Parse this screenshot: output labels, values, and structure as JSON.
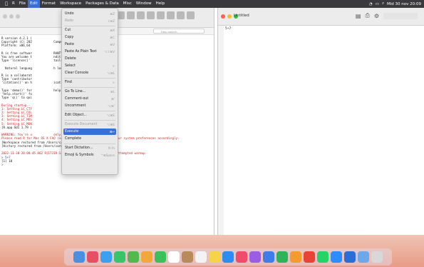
{
  "menubar": {
    "apple": "",
    "items": [
      "R",
      "File",
      "Edit",
      "Format",
      "Workspace",
      "Packages & Data",
      "Misc",
      "Window",
      "Help"
    ],
    "active_index": 2,
    "clock": "Mid 30 nov 20:09"
  },
  "console": {
    "help_search_placeholder": "Help search",
    "lines": [
      {
        "t": "R version 4.2.1 (",
        "c": "black"
      },
      {
        "t": "Copyright (C) 202            Computing",
        "c": "black"
      },
      {
        "t": "Platform: x86_64",
        "c": "black"
      },
      {
        "t": "",
        "c": "black"
      },
      {
        "t": "R is free softwar            RANTY.",
        "c": "black"
      },
      {
        "t": "You are welcome t            nditions.",
        "c": "black"
      },
      {
        "t": "Type 'license()'             tails.",
        "c": "black"
      },
      {
        "t": "",
        "c": "black"
      },
      {
        "t": "  Natural languag            h locale",
        "c": "black"
      },
      {
        "t": "",
        "c": "black"
      },
      {
        "t": "R is a collaborat",
        "c": "black"
      },
      {
        "t": "Type 'contributor",
        "c": "black"
      },
      {
        "t": "'citation()' on h            ications.",
        "c": "black"
      },
      {
        "t": "",
        "c": "black"
      },
      {
        "t": "Type 'demo()' for            help, or",
        "c": "black"
      },
      {
        "t": "'help.start()' fo",
        "c": "black"
      },
      {
        "t": "Type 'q()' to qui",
        "c": "black"
      },
      {
        "t": "",
        "c": "black"
      },
      {
        "t": "During startup -",
        "c": "red"
      },
      {
        "t": "1: Setting LC_CTY",
        "c": "red"
      },
      {
        "t": "2: Setting LC_COL",
        "c": "red"
      },
      {
        "t": "3: Setting LC_TIM",
        "c": "red"
      },
      {
        "t": "4: Setting LC_MES",
        "c": "red"
      },
      {
        "t": "5: Setting LC_MON",
        "c": "red"
      },
      {
        "t": "[R.app GUI 1.79 (",
        "c": "black"
      },
      {
        "t": "",
        "c": "black"
      },
      {
        "t": "WARNING: You're u            only ASCII characters will work.",
        "c": "red"
      },
      {
        "t": "Please read R for Mac OS X FAQ (see Help) section 9 and adjust your system preferences accordingly.",
        "c": "red"
      },
      {
        "t": "[Workspace restored from /Users/carmenmoreno/.RData]",
        "c": "black"
      },
      {
        "t": "[History restored from /Users/carmenmoreno/.Rapp.history]",
        "c": "black"
      },
      {
        "t": "",
        "c": "black"
      },
      {
        "t": "2022-11-30 20:08:45.862 R[17219:1487245] +[NSSavePanel _warmUp] attempted warmup",
        "c": "red"
      },
      {
        "t": "> 5+7",
        "c": "blue"
      },
      {
        "t": "[1] 10",
        "c": "black"
      },
      {
        "t": ">",
        "c": "blue"
      }
    ]
  },
  "edit_menu": [
    {
      "label": "Undo",
      "sc": "⌘Z",
      "disabled": false,
      "sep_after": false
    },
    {
      "label": "Redo",
      "sc": "⇧⌘Z",
      "disabled": true,
      "sep_after": true
    },
    {
      "label": "Cut",
      "sc": "⌘X",
      "disabled": false,
      "sep_after": false
    },
    {
      "label": "Copy",
      "sc": "⌘C",
      "disabled": false,
      "sep_after": false
    },
    {
      "label": "Paste",
      "sc": "⌘V",
      "disabled": false,
      "sep_after": false
    },
    {
      "label": "Paste As Plain Text",
      "sc": "⌥⇧⌘V",
      "disabled": false,
      "sep_after": false
    },
    {
      "label": "Delete",
      "sc": "",
      "disabled": false,
      "sep_after": false
    },
    {
      "label": "Select",
      "sc": ">",
      "disabled": false,
      "sep_after": false
    },
    {
      "label": "Clear Console",
      "sc": "⌥⌘L",
      "disabled": false,
      "sep_after": true
    },
    {
      "label": "Find",
      "sc": ">",
      "disabled": false,
      "sep_after": true
    },
    {
      "label": "Go To Line...",
      "sc": "⌘L",
      "disabled": false,
      "sep_after": false
    },
    {
      "label": "Comment-out",
      "sc": "⌘'",
      "disabled": false,
      "sep_after": false
    },
    {
      "label": "Uncomment",
      "sc": "⌥⌘'",
      "disabled": false,
      "sep_after": true
    },
    {
      "label": "Edit Object...",
      "sc": "⌥⌘E",
      "disabled": false,
      "sep_after": true
    },
    {
      "label": "Execute Document",
      "sc": "⌥⌘E",
      "disabled": true,
      "sep_after": false
    },
    {
      "label": "Execute",
      "sc": "⌘↩",
      "disabled": false,
      "selected": true,
      "sep_after": false
    },
    {
      "label": "Complete",
      "sc": "",
      "disabled": false,
      "sep_after": true
    },
    {
      "label": "Start Dictation...",
      "sc": "fn fn",
      "disabled": false,
      "sep_after": false
    },
    {
      "label": "Emoji & Symbols",
      "sc": "^⌘Space",
      "disabled": false,
      "sep_after": false
    }
  ],
  "editor": {
    "title": "Untitled",
    "code": "5+7"
  },
  "colors": {
    "menubar": "#3a3a3c",
    "selection": "#3a6fd8"
  },
  "dock_icons": [
    "finder-icon",
    "launchpad-icon",
    "safari-icon",
    "messages-icon",
    "maps-icon",
    "photos-icon",
    "facetime-icon",
    "calendar-icon",
    "contacts-icon",
    "reminders-icon",
    "notes-icon",
    "appstore-icon",
    "music-icon",
    "podcasts-icon",
    "keynote-icon",
    "numbers-icon",
    "pages-icon",
    "chrome-icon",
    "whatsapp-icon",
    "zoom-icon",
    "r-icon",
    "folder-icon",
    "trash-icon"
  ]
}
